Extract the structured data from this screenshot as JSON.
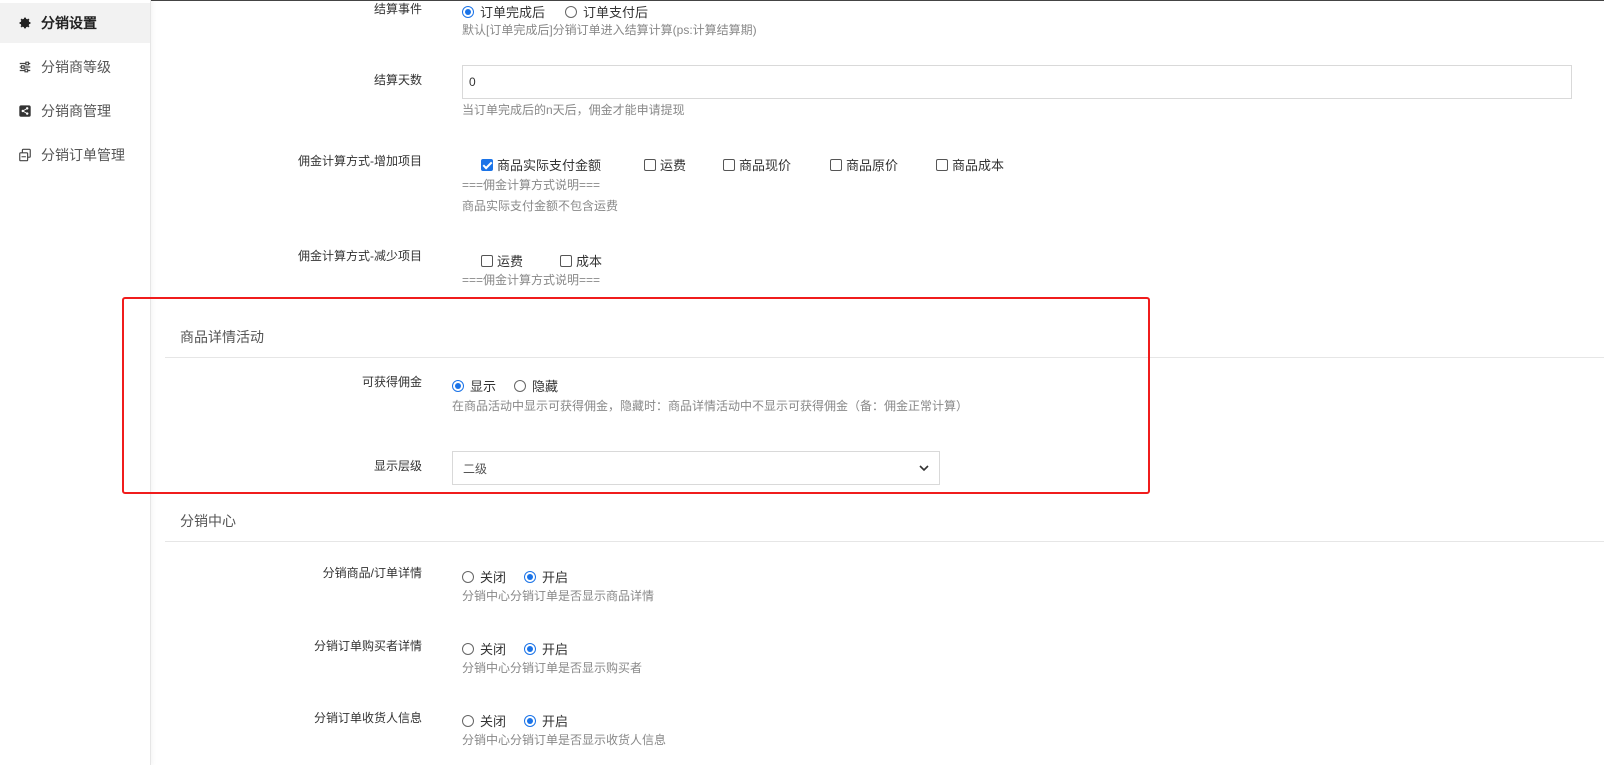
{
  "sidebar": {
    "items": [
      {
        "label": "分销设置",
        "icon": "gear-icon"
      },
      {
        "label": "分销商等级",
        "icon": "sliders-icon"
      },
      {
        "label": "分销商管理",
        "icon": "share-icon"
      },
      {
        "label": "分销订单管理",
        "icon": "order-copy-icon"
      }
    ]
  },
  "form": {
    "settle_event": {
      "label": "结算事件",
      "options": [
        "订单完成后",
        "订单支付后"
      ],
      "selected": "订单完成后",
      "help": "默认[订单完成后]分销订单进入结算计算(ps:计算结算期)"
    },
    "settle_days": {
      "label": "结算天数",
      "value": "0",
      "help": "当订单完成后的n天后，佣金才能申请提现"
    },
    "commission_add": {
      "label": "佣金计算方式-增加项目",
      "options": [
        "商品实际支付金额",
        "运费",
        "商品现价",
        "商品原价",
        "商品成本"
      ],
      "checked": [
        "商品实际支付金额"
      ],
      "help1": "===佣金计算方式说明===",
      "help2": "商品实际支付金额不包含运费"
    },
    "commission_sub": {
      "label": "佣金计算方式-减少项目",
      "options": [
        "运费",
        "成本"
      ],
      "help": "===佣金计算方式说明==="
    }
  },
  "detail_section": {
    "title": "商品详情活动",
    "commission_visible": {
      "label": "可获得佣金",
      "options": [
        "显示",
        "隐藏"
      ],
      "selected": "显示",
      "help": "在商品活动中显示可获得佣金，隐藏时：商品详情活动中不显示可获得佣金（备：佣金正常计算）"
    },
    "display_level": {
      "label": "显示层级",
      "value": "二级"
    }
  },
  "center_section": {
    "title": "分销中心",
    "rows": [
      {
        "label": "分销商品/订单详情",
        "options": [
          "关闭",
          "开启"
        ],
        "selected": "开启",
        "help": "分销中心分销订单是否显示商品详情"
      },
      {
        "label": "分销订单购买者详情",
        "options": [
          "关闭",
          "开启"
        ],
        "selected": "开启",
        "help": "分销中心分销订单是否显示购买者"
      },
      {
        "label": "分销订单收货人信息",
        "options": [
          "关闭",
          "开启"
        ],
        "selected": "开启",
        "help": "分销中心分销订单是否显示收货人信息"
      }
    ]
  },
  "colors": {
    "accent": "#1a73e8",
    "highlight_box": "#f01c1c"
  }
}
